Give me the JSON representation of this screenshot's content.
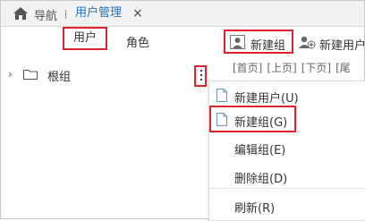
{
  "topbar": {
    "nav_label": "导航",
    "active_tab": "用户管理",
    "close_glyph": "×"
  },
  "subtabs": {
    "user": "用户",
    "role": "角色"
  },
  "toolbar": {
    "new_group": "新建组",
    "new_user": "新建用户"
  },
  "pager": [
    "[首页]",
    "[上页]",
    "[下页]",
    "[尾"
  ],
  "tree": {
    "root_label": "根组"
  },
  "menu": {
    "items": [
      {
        "label": "新建用户(U)",
        "icon": "document-icon"
      },
      {
        "label": "新建组(G)",
        "icon": "document-icon"
      },
      {
        "label": "编辑组(E)"
      },
      {
        "label": "删除组(D)"
      },
      {
        "label": "刷新(R)"
      }
    ]
  },
  "colors": {
    "highlight": "#e0242b",
    "active_tab": "#1f74c2"
  }
}
